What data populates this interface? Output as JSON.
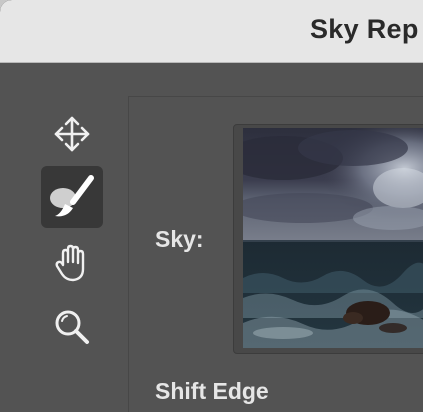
{
  "window": {
    "title": "Sky Rep"
  },
  "toolbar": {
    "tools": [
      {
        "name": "move",
        "icon": "move-arrows-icon",
        "active": false
      },
      {
        "name": "sky-brush",
        "icon": "sky-brush-icon",
        "active": true
      },
      {
        "name": "hand",
        "icon": "hand-icon",
        "active": false
      },
      {
        "name": "zoom",
        "icon": "zoom-icon",
        "active": false
      }
    ]
  },
  "panel": {
    "sky_label": "Sky:",
    "shift_edge_label": "Shift Edge",
    "sky_preview": "stormy-sea-sky-image"
  }
}
